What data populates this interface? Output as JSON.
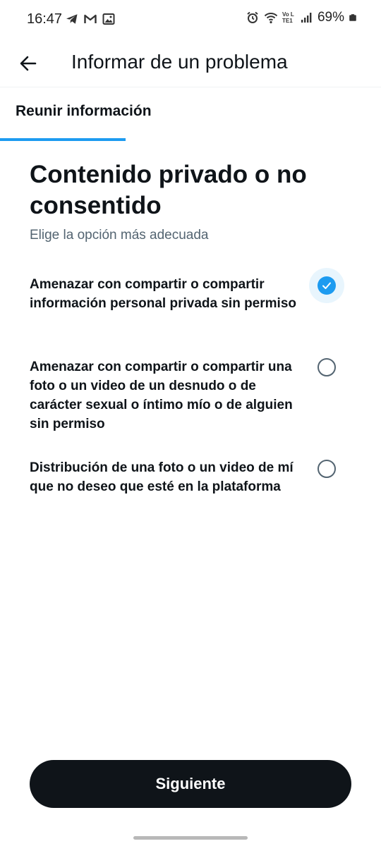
{
  "status_bar": {
    "time": "16:47",
    "battery": "69%",
    "left_icons": [
      "telegram-icon",
      "gmail-icon",
      "image-icon"
    ],
    "right_icons": [
      "alarm-icon",
      "wifi-icon",
      "volte-icon",
      "signal-icon",
      "battery-icon"
    ],
    "volte_text": "Vo LTE1"
  },
  "header": {
    "back_icon": "arrow-left-icon",
    "title": "Informar de un problema"
  },
  "tabs": [
    {
      "label": "Reunir información",
      "active": true
    }
  ],
  "content": {
    "title": "Contenido privado o no consentido",
    "subtitle": "Elige la opción más adecuada",
    "options": [
      {
        "label": "Amenazar con compartir o compartir información personal privada sin permiso",
        "selected": true
      },
      {
        "label": "Amenazar con compartir o compartir una foto o un video de un desnudo o de carácter sexual o íntimo mío o de alguien sin permiso",
        "selected": false
      },
      {
        "label": "Distribución de una foto o un video de mí que no deseo que esté en la plataforma",
        "selected": false
      }
    ]
  },
  "footer": {
    "next_label": "Siguiente"
  },
  "colors": {
    "accent": "#1d9bf0",
    "text_primary": "#0f1419",
    "text_secondary": "#536471",
    "button_bg": "#0f1419"
  }
}
